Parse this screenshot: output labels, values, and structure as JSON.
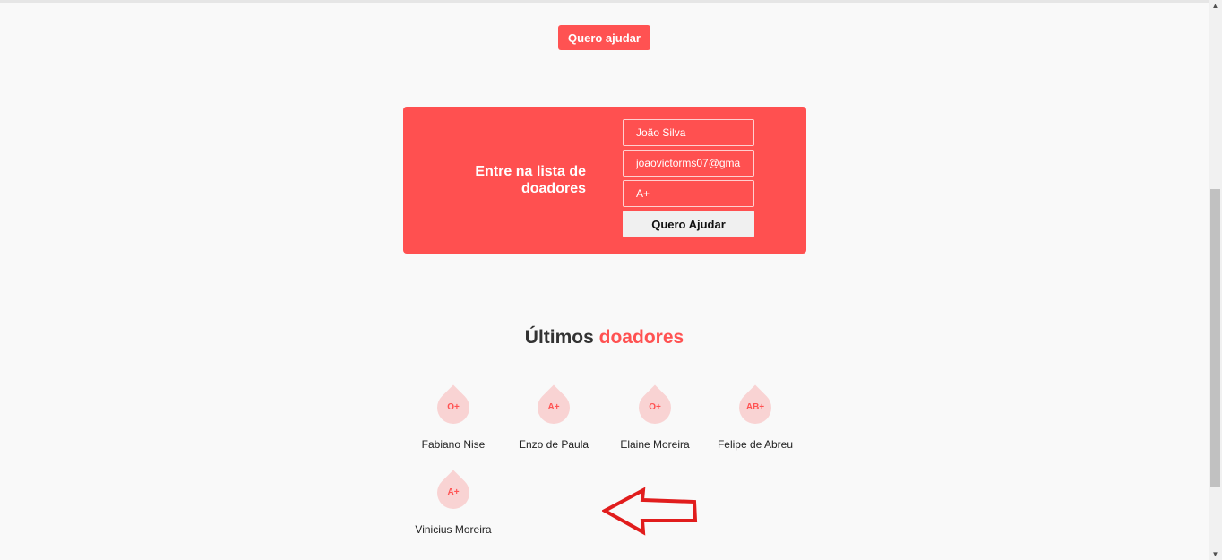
{
  "header": {
    "cta_label": "Quero ajudar"
  },
  "signup": {
    "title": "Entre na lista de doadores",
    "name_value": "João Silva",
    "email_value": "joaovictorms07@gma",
    "blood_value": "A+",
    "submit_label": "Quero Ajudar"
  },
  "donors_section": {
    "title_prefix": "Últimos",
    "title_accent": "doadores",
    "donors": [
      {
        "blood": "O+",
        "name": "Fabiano Nise"
      },
      {
        "blood": "A+",
        "name": "Enzo de Paula"
      },
      {
        "blood": "O+",
        "name": "Elaine Moreira"
      },
      {
        "blood": "AB+",
        "name": "Felipe de Abreu"
      },
      {
        "blood": "A+",
        "name": "Vinicius Moreira"
      }
    ]
  },
  "colors": {
    "accent": "#ff5252",
    "card": "#ff5050",
    "drop_fill": "#f9d3d3",
    "annotation_arrow": "#e11d1d"
  },
  "icons": {
    "annotation": "left-arrow-icon"
  }
}
